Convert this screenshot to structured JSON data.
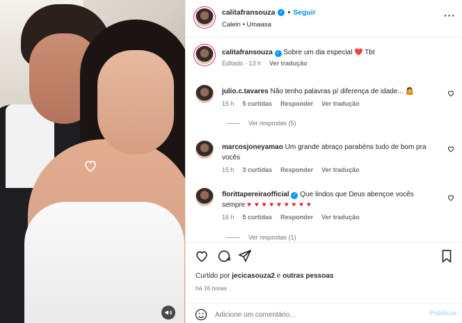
{
  "post": {
    "username": "calitafransouza",
    "follow_label": "Seguir",
    "dot": "•",
    "location": "Calein • Umaasa",
    "more_icon": "more-horizontal-icon"
  },
  "caption": {
    "username": "calitafransouza",
    "text": "Sobre um dia especial",
    "emoji": "❤️",
    "suffix": "Tbt",
    "edited": "Editado · 13 h",
    "translate": "Ver tradução"
  },
  "comments": [
    {
      "username": "julio.c.tavares",
      "text": "Não tenho palavras p/ diferença de idade... 🤷",
      "time": "15 h",
      "likes": "5 curtidas",
      "reply": "Responder",
      "translate": "Ver tradução",
      "view_replies": "Ver respostas (5)"
    },
    {
      "username": "marcosjoneyamao",
      "text": "Um grande abraço parabéns tudo de bom pra vocês",
      "time": "15 h",
      "likes": "3 curtidas",
      "reply": "Responder",
      "translate": "Ver tradução"
    },
    {
      "username": "florittapereiraofficial",
      "text": "Que lindos que Deus abençoe vocês sempre",
      "hearts": "♥ ♥ ♥ ♥ ♥ ♥ ♥ ♥ ♥",
      "time": "16 h",
      "likes": "5 curtidas",
      "reply": "Responder",
      "translate": "Ver tradução",
      "view_replies": "Ver respostas (1)"
    }
  ],
  "actions": {
    "liked_prefix": "Curtido por",
    "liked_user": "jecicasouza2",
    "liked_and": "e",
    "liked_others": "outras pessoas",
    "time_ago": "há 16 horas"
  },
  "composer": {
    "placeholder": "Adicione um comentário...",
    "publish_label": "Publicar"
  },
  "colors": {
    "accent": "#0095f6",
    "heart_red": "#ed1c3a",
    "muted": "#737373"
  }
}
